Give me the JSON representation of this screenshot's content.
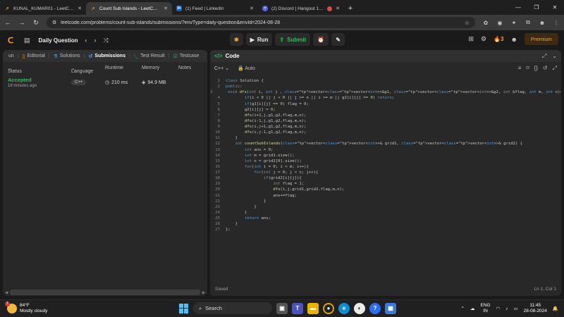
{
  "browser": {
    "tabs": [
      {
        "label": "KUNAL_KUMAR01 - LeetCode P",
        "icon": "leetcode-icon",
        "active": false
      },
      {
        "label": "Count Sub Islands - LeetCode",
        "icon": "leetcode-icon",
        "active": true
      },
      {
        "label": "(1) Feed | LinkedIn",
        "icon": "linkedin-icon",
        "active": false
      },
      {
        "label": "(2) Discord | Hangout 1 | H",
        "icon": "discord-icon",
        "active": false
      }
    ],
    "url": "leetcode.com/problems/count-sub-islands/submissions/?envType=daily-question&envId=2024-08-28"
  },
  "header": {
    "title": "Daily Question",
    "run_label": "Run",
    "submit_label": "Submit",
    "streak": "3",
    "premium_label": "Premium"
  },
  "left": {
    "tabs": [
      {
        "label": "Editorial"
      },
      {
        "label": "Solutions"
      },
      {
        "label": "Submissions"
      },
      {
        "label": "Test Result"
      },
      {
        "label": "Testcase"
      }
    ],
    "columns": {
      "status": "Status",
      "language": "Language",
      "runtime": "Runtime",
      "memory": "Memory",
      "notes": "Notes"
    },
    "submission": {
      "status": "Accepted",
      "time": "18 minutes ago",
      "language": "C++",
      "runtime": "210 ms",
      "memory": "94.9 MB"
    }
  },
  "right": {
    "title": "Code",
    "language": "C++",
    "autosave": "Auto",
    "footer_status": "Saved",
    "cursor": "Ln 1, Col 1",
    "code_lines": [
      "class Solution {",
      "public:",
      "    void dfs(int i, int j , vector<vector<int>>&g1, vector<vector<int>>&g2, int &flag, int m, int n){",
      "        if(i < 0 || j < 0 || j >= n || i >= m || g2[i][j] == 0) return;",
      "        if(g1[i][j] == 0) flag = 0;",
      "        g2[i][j] = 0;",
      "        dfs(i+1,j,g1,g2,flag,m,n);",
      "        dfs(i-1,j,g1,g2,flag,m,n);",
      "        dfs(i,j+1,g1,g2,flag,m,n);",
      "        dfs(i,j-1,g1,g2,flag,m,n);",
      "    }",
      "    int countSubIslands(vector<vector<int>>& grid1, vector<vector<int>>& grid2) {",
      "        int ans = 0;",
      "        int m = grid1.size();",
      "        int n = grid2[0].size();",
      "        for(int i = 0; i < m; i++){",
      "            for(int j = 0; j < n; j++){",
      "                if(grid2[i][j]){",
      "                    int flag = 1;",
      "                    dfs(i,j,grid1,grid2,flag,m,n);",
      "                    ans+=flag;",
      "                }",
      "            }",
      "        }",
      "        return ans;",
      "    }",
      "};"
    ]
  },
  "taskbar": {
    "temperature": "84°F",
    "weather": "Mostly cloudy",
    "weather_badge": "1",
    "search_label": "Search",
    "language": "ENG",
    "region": "IN",
    "clock_time": "11:45",
    "clock_date": "28-08-2024"
  },
  "colors": {
    "accent_orange": "#ffa116",
    "accepted_green": "#2cbb5d",
    "panel": "#282828",
    "background": "#1a1a1a"
  }
}
